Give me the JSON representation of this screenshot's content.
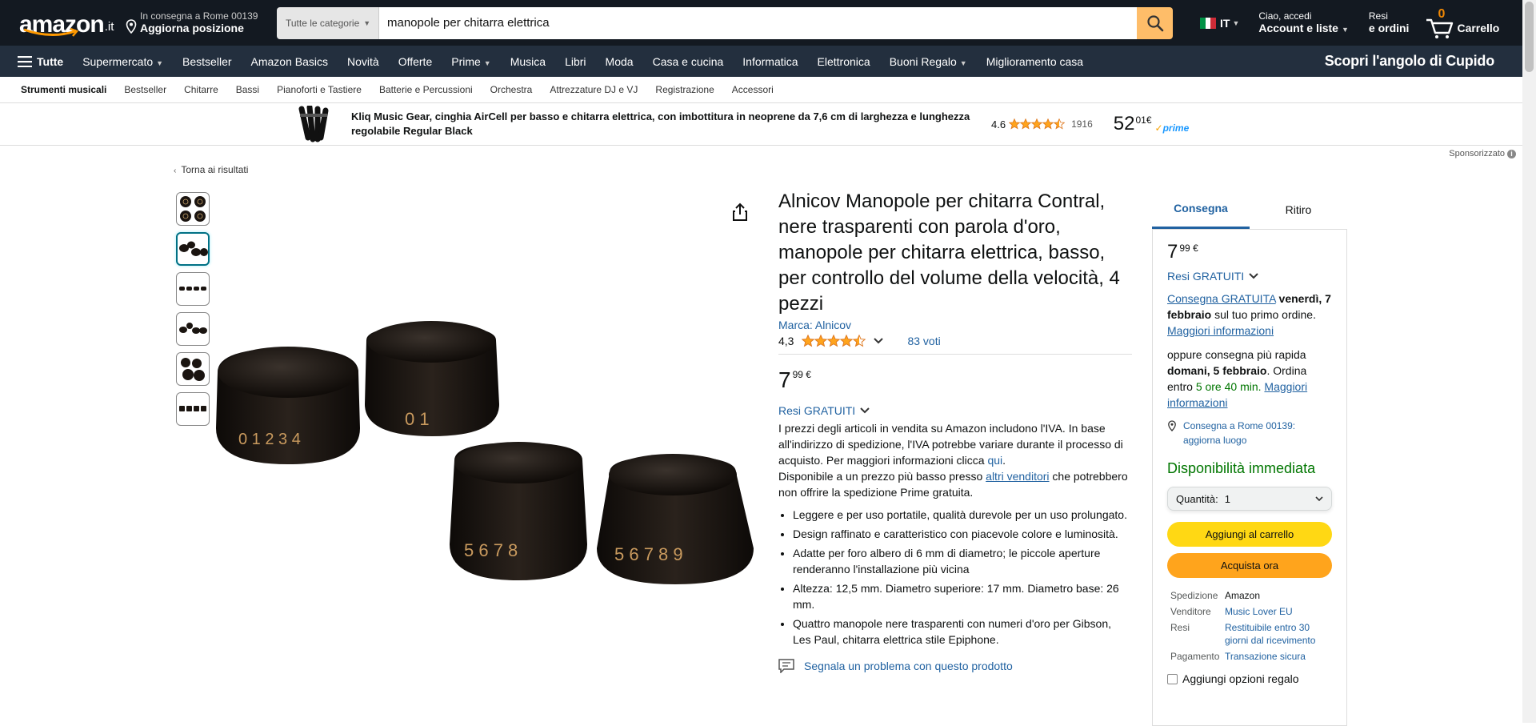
{
  "header": {
    "logo": "amazon",
    "logo_tld": ".it",
    "location_line1": "In consegna a Rome 00139",
    "location_line2": "Aggiorna posizione",
    "search_category": "Tutte le categorie",
    "search_value": "manopole per chitarra elettrica",
    "language": "IT",
    "account_line1": "Ciao, accedi",
    "account_line2": "Account e liste",
    "orders_line1": "Resi",
    "orders_line2": "e ordini",
    "cart_count": "0",
    "cart_label": "Carrello"
  },
  "main_nav": {
    "all_label": "Tutte",
    "items": [
      "Supermercato",
      "Bestseller",
      "Amazon Basics",
      "Novità",
      "Offerte",
      "Prime",
      "Musica",
      "Libri",
      "Moda",
      "Casa e cucina",
      "Informatica",
      "Elettronica",
      "Buoni Regalo",
      "Miglioramento casa"
    ],
    "promo": "Scopri l'angolo di Cupido"
  },
  "sub_nav": {
    "items": [
      "Strumenti musicali",
      "Bestseller",
      "Chitarre",
      "Bassi",
      "Pianoforti e Tastiere",
      "Batterie e Percussioni",
      "Orchestra",
      "Attrezzature DJ e VJ",
      "Registrazione",
      "Accessori"
    ]
  },
  "ad": {
    "title": "Kliq Music Gear, cinghia AirCell per basso e chitarra elettrica, con imbottitura in neoprene da 7,6 cm di larghezza e lunghezza regolabile Regular Black",
    "rating": "4.6",
    "stars": 4.5,
    "review_count": "1916",
    "price_whole": "52",
    "price_fraction": "01",
    "currency": "€",
    "prime": "prime",
    "sponsored": "Sponsorizzato"
  },
  "back_link": "Torna ai risultati",
  "product": {
    "title": "Alnicov Manopole per chitarra Contral, nere trasparenti con parola d'oro, manopole per chitarra elettrica, basso, per controllo del volume della velocità, 4 pezzi",
    "brand": "Marca: Alnicov",
    "rating": "4,3",
    "stars": 4.5,
    "votes": "83 voti",
    "price_whole": "7",
    "price_fraction": "99",
    "currency": "€",
    "resi": "Resi GRATUITI",
    "vat_text": "I prezzi degli articoli in vendita su Amazon includono l'IVA. In base all'indirizzo di spedizione, l'IVA potrebbe variare durante il processo di acquisto. Per maggiori informazioni clicca ",
    "vat_link": "qui",
    "other_sellers_pre": "Disponibile a un prezzo più basso presso ",
    "other_sellers_link": "altri venditori",
    "other_sellers_post": " che potrebbero non offrire la spedizione Prime gratuita.",
    "bullets": [
      "Leggere e per uso portatile, qualità durevole per un uso prolungato.",
      "Design raffinato e caratteristico con piacevole colore e luminosità.",
      "Adatte per foro albero di 6 mm di diametro; le piccole aperture renderanno l'installazione più vicina",
      "Altezza: 12,5 mm. Diametro superiore: 17 mm. Diametro base: 26 mm.",
      "Quattro manopole nere trasparenti con numeri d'oro per Gibson, Les Paul, chitarra elettrica stile Epiphone."
    ],
    "report": "Segnala un problema con questo prodotto",
    "thumbnail_count": 6,
    "active_thumbnail": 2
  },
  "buybox": {
    "tab_delivery": "Consegna",
    "tab_pickup": "Ritiro",
    "price_whole": "7",
    "price_fraction": "99",
    "currency": "€",
    "resi": "Resi GRATUITI",
    "free_delivery_link": "Consegna GRATUITA",
    "free_delivery_date": "venerdì, 7 febbraio",
    "free_delivery_post": " sul tuo primo ordine.",
    "more_info": "Maggiori informazioni",
    "fast_pre": "oppure consegna più rapida ",
    "fast_date": "domani, 5 febbraio",
    "fast_mid": ". Ordina entro ",
    "fast_time": "5 ore 40 min.",
    "fast_more": "Maggiori informazioni",
    "deliver_to": "Consegna a Rome 00139: aggiorna luogo",
    "availability": "Disponibilità immediata",
    "qty_label": "Quantità:",
    "qty_value": "1",
    "add_to_cart": "Aggiungi al carrello",
    "buy_now": "Acquista ora",
    "facts": [
      {
        "k": "Spedizione",
        "v": "Amazon",
        "link": false
      },
      {
        "k": "Venditore",
        "v": "Music Lover EU",
        "link": true
      },
      {
        "k": "Resi",
        "v": "Restituibile entro 30 giorni dal ricevimento",
        "link": true
      },
      {
        "k": "Pagamento",
        "v": "Transazione sicura",
        "link": true
      }
    ],
    "gift": "Aggiungi opzioni regalo"
  },
  "colors": {
    "nav_dark": "#131921",
    "nav_mid": "#232f3e",
    "search_btn": "#febd69",
    "cart_btn": "#ffd814",
    "buy_btn": "#ffa41c",
    "link": "#2162a1",
    "green": "#007600",
    "star": "#ffa41c"
  }
}
